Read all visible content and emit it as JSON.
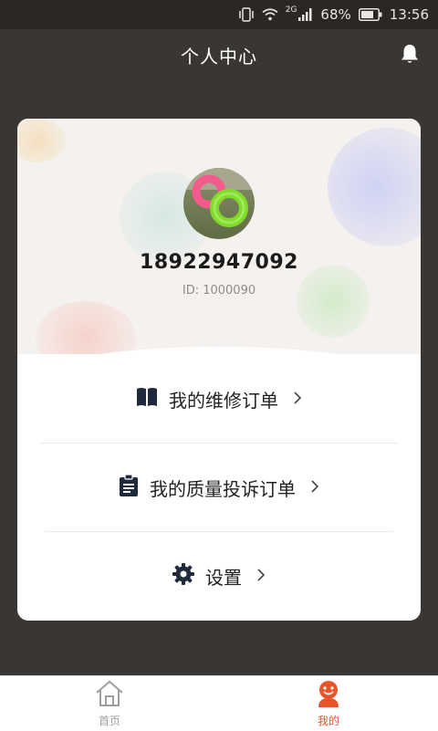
{
  "status_bar": {
    "network": "2G",
    "battery": "68%",
    "time": "13:56"
  },
  "header": {
    "title": "个人中心"
  },
  "profile": {
    "phone": "18922947092",
    "user_id": "ID: 1000090"
  },
  "menu": [
    {
      "label": "我的维修订单",
      "icon": "book-icon"
    },
    {
      "label": "我的质量投诉订单",
      "icon": "clipboard-icon"
    },
    {
      "label": "设置",
      "icon": "gear-icon"
    }
  ],
  "tabs": [
    {
      "label": "首页",
      "icon": "home-icon",
      "active": false
    },
    {
      "label": "我的",
      "icon": "user-mascot-icon",
      "active": true
    }
  ],
  "colors": {
    "accent": "#e8552a",
    "header_bg": "#3a3633",
    "inactive_tab": "#9e9e9e"
  }
}
